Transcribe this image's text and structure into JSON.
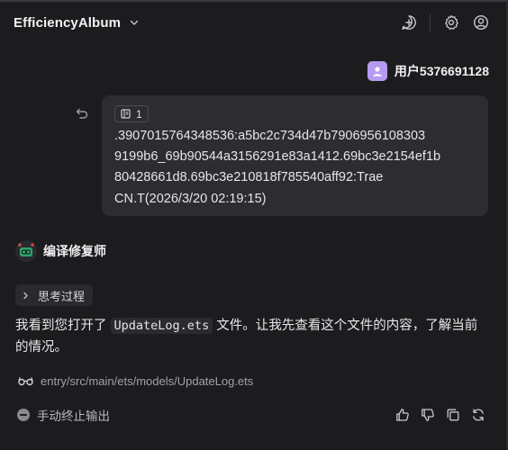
{
  "header": {
    "app_title": "EfficiencyAlbum",
    "icons": [
      "chevron-down-icon",
      "new-chat-icon",
      "settings-icon",
      "account-icon"
    ]
  },
  "user": {
    "name": "用户5376691128",
    "avatar_color": "#b79af0"
  },
  "message": {
    "ref_count": "1",
    "text": ".3907015764348536:a5bc2c734d47b7906956108303\n9199b6_69b90544a3156291e83a1412.69bc3e2154ef1b\n80428661d8.69bc3e210818f785540aff92:Trae\nCN.T(2026/3/20 02:19:15)"
  },
  "assistant": {
    "name": "编译修复师",
    "think_label": "思考过程",
    "reply_before": "我看到您打开了 ",
    "reply_code": "UpdateLog.ets",
    "reply_after": " 文件。让我先查看这个文件的内容，了解当前的情况。",
    "file_path": "entry/src/main/ets/models/UpdateLog.ets",
    "stop_label": "手动终止输出"
  },
  "actions": [
    "thumbs-up-icon",
    "thumbs-down-icon",
    "copy-icon",
    "regenerate-icon"
  ],
  "colors": {
    "background": "#1c1c1f",
    "bubble": "#2d2d31",
    "text": "#e6e6e9",
    "muted": "#a2a2a8"
  }
}
